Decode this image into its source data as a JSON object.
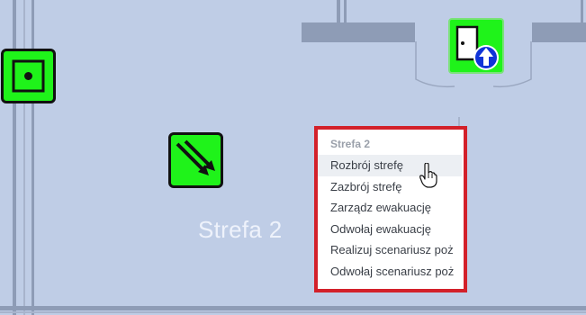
{
  "map": {
    "zone_label": "Strefa 2"
  },
  "devices": [
    {
      "name": "square-sensor-icon",
      "color": "#1ff31a"
    },
    {
      "name": "motion-detector-icon",
      "color": "#1ff31a"
    },
    {
      "name": "exit-door-icon",
      "color": "#1ff31a"
    }
  ],
  "context_menu": {
    "title": "Strefa 2",
    "items": [
      {
        "label": "Rozbrój strefę"
      },
      {
        "label": "Zazbrój strefę"
      },
      {
        "label": "Zarządz ewakuację"
      },
      {
        "label": "Odwołaj ewakuację"
      },
      {
        "label": "Realizuj scenariusz poż"
      },
      {
        "label": "Odwołaj scenariusz poż"
      }
    ],
    "highlight_color": "#d3202a"
  }
}
